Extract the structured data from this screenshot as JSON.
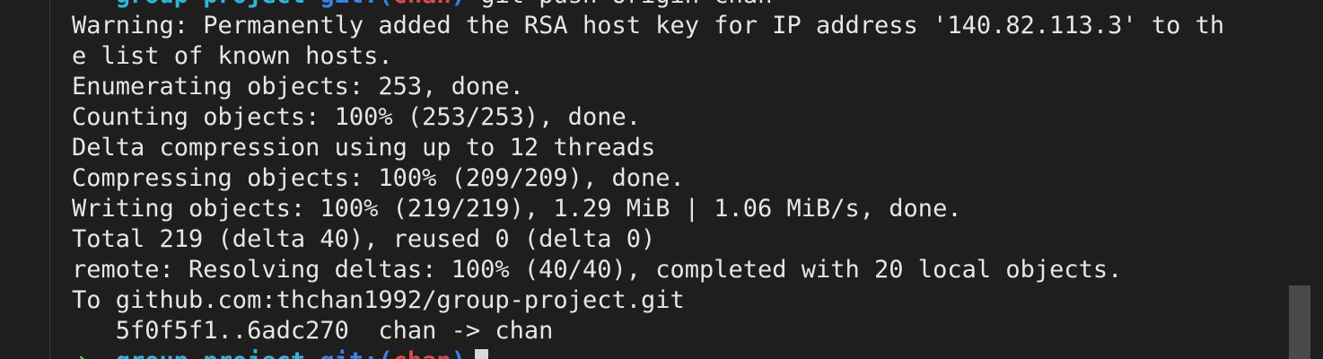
{
  "prompt_top": {
    "arrow": "➜",
    "dir": "group-project",
    "git_open": "git:(",
    "branch": "chan",
    "git_close": ")",
    "command": "git push origin chan"
  },
  "output": [
    "Warning: Permanently added the RSA host key for IP address '140.82.113.3' to th",
    "e list of known hosts.",
    "Enumerating objects: 253, done.",
    "Counting objects: 100% (253/253), done.",
    "Delta compression using up to 12 threads",
    "Compressing objects: 100% (209/209), done.",
    "Writing objects: 100% (219/219), 1.29 MiB | 1.06 MiB/s, done.",
    "Total 219 (delta 40), reused 0 (delta 0)",
    "remote: Resolving deltas: 100% (40/40), completed with 20 local objects.",
    "To github.com:thchan1992/group-project.git",
    "   5f0f5f1..6adc270  chan -> chan"
  ],
  "prompt_bottom": {
    "arrow": "➜",
    "dir": "group-project",
    "git_open": "git:(",
    "branch": "chan",
    "git_close": ")"
  },
  "colors": {
    "background": "#1e1e1e",
    "text": "#e6e6e6",
    "arrow": "#4ec94e",
    "dir": "#2fb5d8",
    "git": "#3a80e8",
    "branch": "#e04848"
  }
}
